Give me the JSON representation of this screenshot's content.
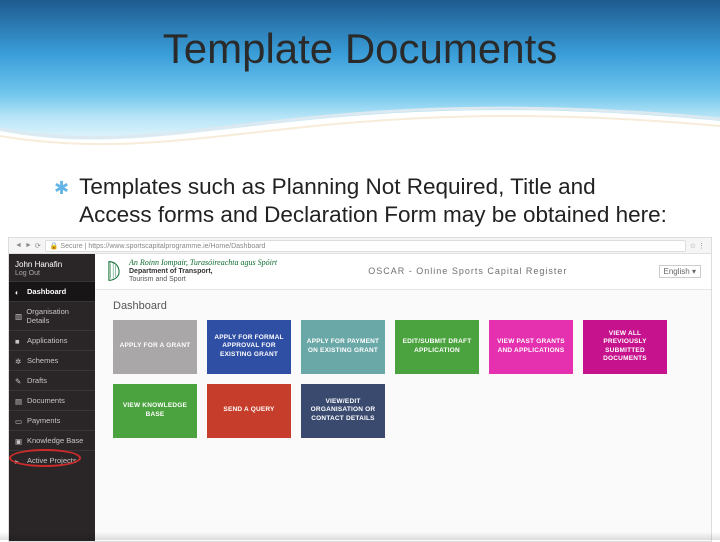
{
  "slide": {
    "title": "Template Documents",
    "bullet": "Templates such as Planning Not Required, Title and Access forms and Declaration Form may be obtained here:"
  },
  "browser": {
    "url": "https://www.sportscapitalprogramme.ie/Home/Dashboard",
    "secure_label": "Secure"
  },
  "sidebar": {
    "user_name": "John Hanafin",
    "logout": "Log Out",
    "items": [
      {
        "label": "Dashboard",
        "icon": "tachometer-icon",
        "active": true
      },
      {
        "label": "Organisation Details",
        "icon": "building-icon"
      },
      {
        "label": "Applications",
        "icon": "folder-icon"
      },
      {
        "label": "Schemes",
        "icon": "cog-icon"
      },
      {
        "label": "Drafts",
        "icon": "pencil-icon"
      },
      {
        "label": "Documents",
        "icon": "file-icon",
        "circled": true
      },
      {
        "label": "Payments",
        "icon": "credit-card-icon"
      },
      {
        "label": "Knowledge Base",
        "icon": "book-icon"
      },
      {
        "label": "Active Projects",
        "icon": "flag-icon"
      }
    ]
  },
  "header": {
    "logo_ga": "An Roinn Iompair, Turasóireachta agus Spóirt",
    "logo_en1": "Department of Transport,",
    "logo_en2": "Tourism and Sport",
    "app_title": "OSCAR - Online Sports Capital Register",
    "language": "English"
  },
  "dashboard": {
    "heading": "Dashboard",
    "row1": [
      {
        "label": "APPLY FOR A GRANT",
        "color": "grey"
      },
      {
        "label": "APPLY FOR FORMAL APPROVAL FOR EXISTING GRANT",
        "color": "blue"
      },
      {
        "label": "APPLY FOR PAYMENT ON EXISTING GRANT",
        "color": "teal"
      },
      {
        "label": "EDIT/SUBMIT DRAFT APPLICATION",
        "color": "green"
      },
      {
        "label": "VIEW PAST GRANTS AND APPLICATIONS",
        "color": "pink"
      },
      {
        "label": "VIEW ALL PREVIOUSLY SUBMITTED DOCUMENTS",
        "color": "magenta"
      }
    ],
    "row2": [
      {
        "label": "VIEW KNOWLEDGE BASE",
        "color": "green2"
      },
      {
        "label": "SEND A QUERY",
        "color": "red"
      },
      {
        "label": "VIEW/EDIT ORGANISATION OR CONTACT DETAILS",
        "color": "navy"
      }
    ]
  }
}
